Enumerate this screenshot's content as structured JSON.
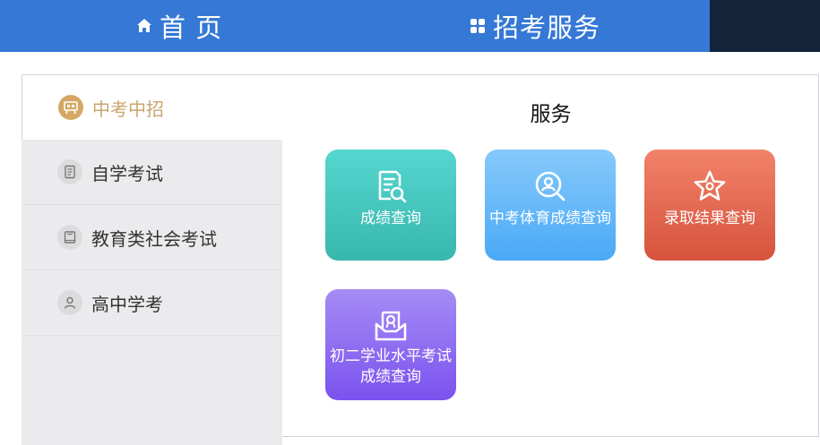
{
  "nav": {
    "home_label": "首 页",
    "service_label": "招考服务"
  },
  "sidebar": {
    "items": [
      {
        "label": "中考中招",
        "active": true
      },
      {
        "label": "自学考试",
        "active": false
      },
      {
        "label": "教育类社会考试",
        "active": false
      },
      {
        "label": "高中学考",
        "active": false
      }
    ]
  },
  "main": {
    "title": "服务",
    "cards": [
      {
        "label": "成绩查询",
        "icon": "document-search-icon"
      },
      {
        "label": "中考体育成绩查询",
        "icon": "location-search-icon"
      },
      {
        "label": "录取结果查询",
        "icon": "star-icon"
      },
      {
        "label_line1": "初二学业水平考试",
        "label_line2": "成绩查询",
        "icon": "inbox-certificate-icon"
      }
    ]
  },
  "colors": {
    "topbar": "#3578d6",
    "topbar_dark": "#13243a",
    "active_accent": "#c9a56d",
    "sidebar_bg": "#ebebed"
  }
}
